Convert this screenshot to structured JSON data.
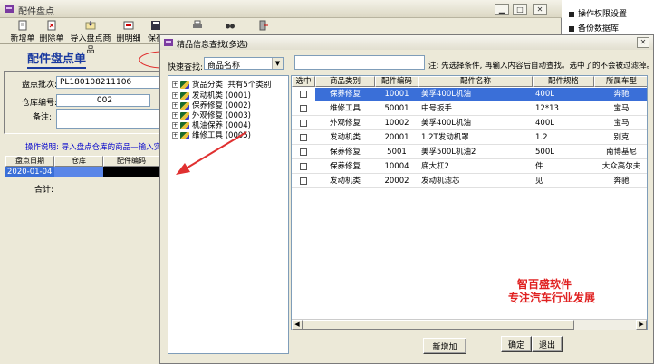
{
  "main_window": {
    "title": "配件盘点",
    "toolbar": [
      "新增单",
      "删除单",
      "导入盘点商品",
      "删明细",
      "保存",
      "",
      "选择",
      "关闭"
    ],
    "form_title": "配件盘点单",
    "fields": {
      "batch_label": "盘点批次:",
      "batch_value": "PL180108211106",
      "warehouse_code_label": "仓库编号:",
      "warehouse_code_value": "002",
      "remark_label": "备注:",
      "remark_value": ""
    },
    "instruction": "操作说明: 导入盘点仓库的商品—输入实际",
    "grid_headers": [
      "盘点日期",
      "仓库",
      "配件编码"
    ],
    "grid_row": {
      "date": "2020-01-04"
    },
    "total_label": "合计:"
  },
  "side_panel": {
    "items": [
      "操作权限设置",
      "备份数据库"
    ]
  },
  "dialog": {
    "title": "精品信息查找(多选)",
    "quick_search_label": "快速查找:",
    "quick_search_value": "商品名称",
    "search_input_value": "",
    "note": "注: 先选择条件, 再输入内容后自动查找。选中了的不会被过滤掉。",
    "tree": [
      {
        "label": "货品分类",
        "extra": "共有5个类别",
        "root": true
      },
      {
        "label": "发动机类",
        "extra": "(0001)"
      },
      {
        "label": "保养修复",
        "extra": "(0002)"
      },
      {
        "label": "外观修复",
        "extra": "(0003)"
      },
      {
        "label": "机油保养",
        "extra": "(0004)"
      },
      {
        "label": "维修工具",
        "extra": "(0005)"
      }
    ],
    "columns": [
      "选中",
      "商品类别",
      "配件编码",
      "配件名称",
      "配件规格",
      "所属车型"
    ],
    "rows": [
      {
        "category": "保养修复",
        "code": "10001",
        "name": "美孚400L机油",
        "spec": "400L",
        "model": "奔驰",
        "selected": true
      },
      {
        "category": "维修工具",
        "code": "50001",
        "name": "中号扳手",
        "spec": "12*13",
        "model": "宝马",
        "selected": false
      },
      {
        "category": "外观修复",
        "code": "10002",
        "name": "美孚400L机油",
        "spec": "400L",
        "model": "宝马",
        "selected": false
      },
      {
        "category": "发动机类",
        "code": "20001",
        "name": "1.2T发动机罩",
        "spec": "1.2",
        "model": "别克",
        "selected": false
      },
      {
        "category": "保养修复",
        "code": "5001",
        "name": "美孚500L机油2",
        "spec": "500L",
        "model": "南博基尼",
        "selected": false
      },
      {
        "category": "保养修复",
        "code": "10004",
        "name": "底大杠2",
        "spec": "件",
        "model": "大众高尔夫",
        "selected": false
      },
      {
        "category": "发动机类",
        "code": "20002",
        "name": "发动机滤芯",
        "spec": "见",
        "model": "奔驰",
        "selected": false
      }
    ],
    "watermark_line1": "智百盛软件",
    "watermark_line2": "专注汽车行业发展",
    "buttons": {
      "add_new": "新增加",
      "confirm": "确定",
      "exit": "退出"
    }
  },
  "colors": {
    "selection": "#3a6fd8",
    "form_title": "#1a3aa0",
    "instruction": "#0000cc",
    "watermark": "#e02020",
    "arrow": "#e03030"
  }
}
